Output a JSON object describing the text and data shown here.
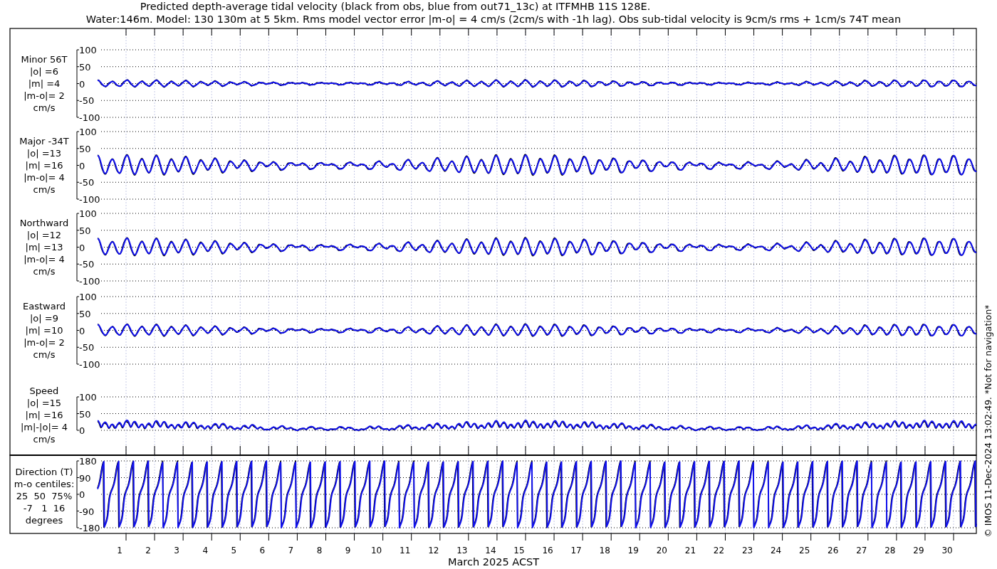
{
  "title_lines": [
    "Predicted depth-average tidal velocity (black from obs, blue from out71_13c) at ITFMHB 11S 128E.",
    "Water:146m. Model: 130 130m at 5 5km. Rms model vector error |m-o| = 4 cm/s (2cm/s with -1h lag). Obs sub-tidal velocity is 9cm/s rms + 1cm/s 74T mean"
  ],
  "panels": [
    {
      "kind": "velocity",
      "label_lines": [
        "Minor 56T",
        "|o| =6",
        "|m| =4",
        "|m-o|= 2",
        "cm/s"
      ],
      "yticks": [
        "100",
        "50",
        "0",
        "-50",
        "-100"
      ]
    },
    {
      "kind": "velocity",
      "label_lines": [
        "Major -34T",
        "|o| =13",
        "|m| =16",
        "|m-o|= 4",
        "cm/s"
      ],
      "yticks": [
        "100",
        "50",
        "0",
        "-50",
        "-100"
      ]
    },
    {
      "kind": "velocity",
      "label_lines": [
        "Northward",
        "|o| =12",
        "|m| =13",
        "|m-o|= 4",
        "cm/s"
      ],
      "yticks": [
        "100",
        "50",
        "0",
        "-50",
        "-100"
      ]
    },
    {
      "kind": "velocity",
      "label_lines": [
        "Eastward",
        "|o| =9",
        "|m| =10",
        "|m-o|= 2",
        "cm/s"
      ],
      "yticks": [
        "100",
        "50",
        "0",
        "-50",
        "-100"
      ]
    },
    {
      "kind": "speed",
      "label_lines": [
        "Speed",
        "|o| =15",
        "|m| =16",
        "|m|-|o|= 4",
        "cm/s"
      ],
      "yticks": [
        "100",
        "50",
        "0"
      ]
    },
    {
      "kind": "direction",
      "label_lines": [
        "Direction (T)",
        "m-o centiles:",
        "25  50  75%",
        "-7   1  16",
        "degrees"
      ],
      "yticks": [
        "180",
        "90",
        "0",
        "-90",
        "-180"
      ]
    }
  ],
  "x_axis": {
    "day_labels": [
      "1",
      "2",
      "3",
      "4",
      "5",
      "6",
      "7",
      "8",
      "9",
      "10",
      "11",
      "12",
      "13",
      "14",
      "15",
      "16",
      "17",
      "18",
      "19",
      "20",
      "21",
      "22",
      "23",
      "24",
      "25",
      "26",
      "27",
      "28",
      "29",
      "30"
    ],
    "label": "March 2025 ACST"
  },
  "footer_note": "© IMOS 11-Dec-2024 13:02:49. *Not for navigation*"
}
